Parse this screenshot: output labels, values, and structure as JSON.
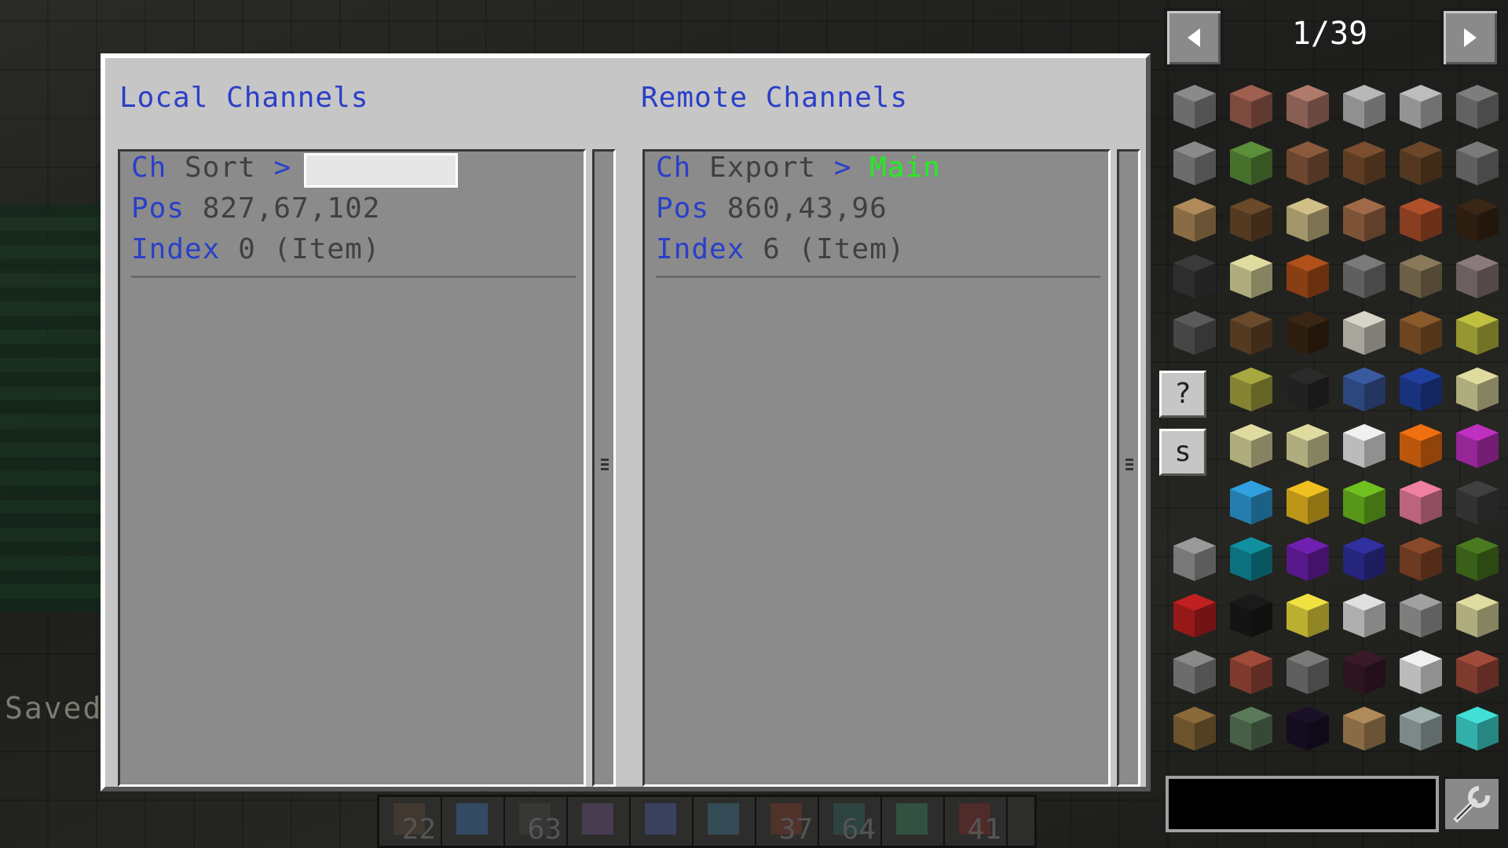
{
  "hud": {
    "saved_text": "Saved"
  },
  "hotbar": {
    "slots": [
      {
        "count": "22",
        "color": "#5a4a3a"
      },
      {
        "count": "",
        "color": "#3b6ea8"
      },
      {
        "count": "63",
        "color": "#444444"
      },
      {
        "count": "",
        "color": "#6a4f7f"
      },
      {
        "count": "",
        "color": "#4a5aa0"
      },
      {
        "count": "",
        "color": "#3e6f8a"
      },
      {
        "count": "37",
        "color": "#7a3a2a"
      },
      {
        "count": "64",
        "color": "#2e5f5a"
      },
      {
        "count": "",
        "color": "#3a7f5a"
      },
      {
        "count": "41",
        "color": "#7a2a2a"
      }
    ]
  },
  "local": {
    "heading": "Local Channels",
    "ch_label": "Ch",
    "ch_value": "Sort",
    "arrow": ">",
    "name_value": "",
    "pos_label": "Pos",
    "pos_value": "827,67,102",
    "index_label": "Index",
    "index_value": "0 (Item)"
  },
  "remote": {
    "heading": "Remote Channels",
    "ch_label": "Ch",
    "ch_value": "Export",
    "arrow": ">",
    "name_value": "Main",
    "pos_label": "Pos",
    "pos_value": "860,43,96",
    "index_label": "Index",
    "index_value": "6 (Item)"
  },
  "item_panel": {
    "page": "1/39",
    "help_label": "?",
    "search_mode_label": "s",
    "search_value": "",
    "items": [
      "#8a8a8a",
      "#a06050",
      "#b07a6a",
      "#b8b8b8",
      "#bdbdbd",
      "#7d7d7d",
      "#8a8a8a",
      "#5b8f3a",
      "#8b5a3c",
      "#7a4e2e",
      "#6b4628",
      "#7a7a7a",
      "#b08a58",
      "#6a4a2a",
      "#d0c088",
      "#a06a48",
      "#b0502a",
      "#3a2614",
      "#3a3a3a",
      "#e0dca0",
      "#b0501a",
      "#7a7a7a",
      "#8a7a5a",
      "#8a7a7a",
      "#5a5a5a",
      "#6a4a2a",
      "#3a2614",
      "#d8d4c8",
      "#8b5a2a",
      "#c0c040",
      "",
      "#a8a840",
      "#2a2a2a",
      "#3a5aa0",
      "#2040a0",
      "#e0dca0",
      "",
      "#e0dca0",
      "#e0dca0",
      "#f0f0f0",
      "#f07010",
      "#c030c0",
      "",
      "#30a0e0",
      "#f0c020",
      "#70c020",
      "#f080a0",
      "#404040",
      "#9a9a9a",
      "#1090a0",
      "#7020b0",
      "#3030a0",
      "#8a4a2a",
      "#4a7a20",
      "#c02020",
      "#1a1a1a",
      "#f0e040",
      "#e0e0e0",
      "#a0a0a0",
      "#e0dca0",
      "#8a8a8a",
      "#a04a3a",
      "#7a7a7a",
      "#3a1a2a",
      "#f0f0f0",
      "#a04a3a",
      "#8a6a3a",
      "#5a7a5a",
      "#1a1028",
      "#b08a58",
      "#a0b0b0",
      "#40e0d8"
    ]
  }
}
